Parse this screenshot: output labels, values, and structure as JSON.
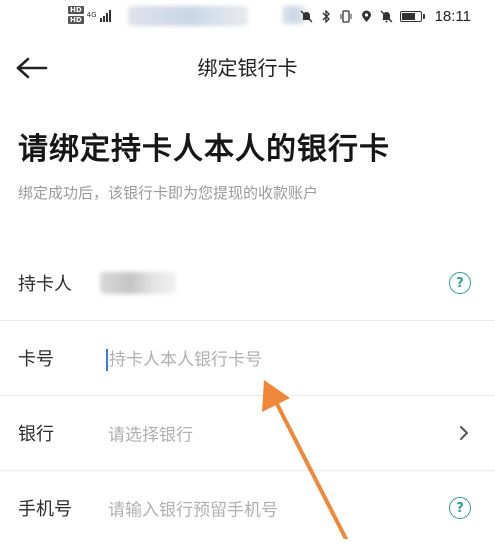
{
  "status_bar": {
    "hd1": "HD",
    "hd2": "HD",
    "network": "4G",
    "time": "18:11"
  },
  "header": {
    "title": "绑定银行卡"
  },
  "headline": "请绑定持卡人本人的银行卡",
  "subtitle": "绑定成功后，该银行卡即为您提现的收款账户",
  "form": {
    "cardholder_label": "持卡人",
    "card_number_label": "卡号",
    "card_number_placeholder": "持卡人本人银行卡号",
    "bank_label": "银行",
    "bank_placeholder": "请选择银行",
    "phone_label": "手机号",
    "phone_placeholder": "请输入银行预留手机号",
    "help_symbol": "?"
  },
  "colors": {
    "accent": "#2aa198",
    "annotation_arrow": "#f0883a",
    "cursor": "#3a7bd5"
  }
}
